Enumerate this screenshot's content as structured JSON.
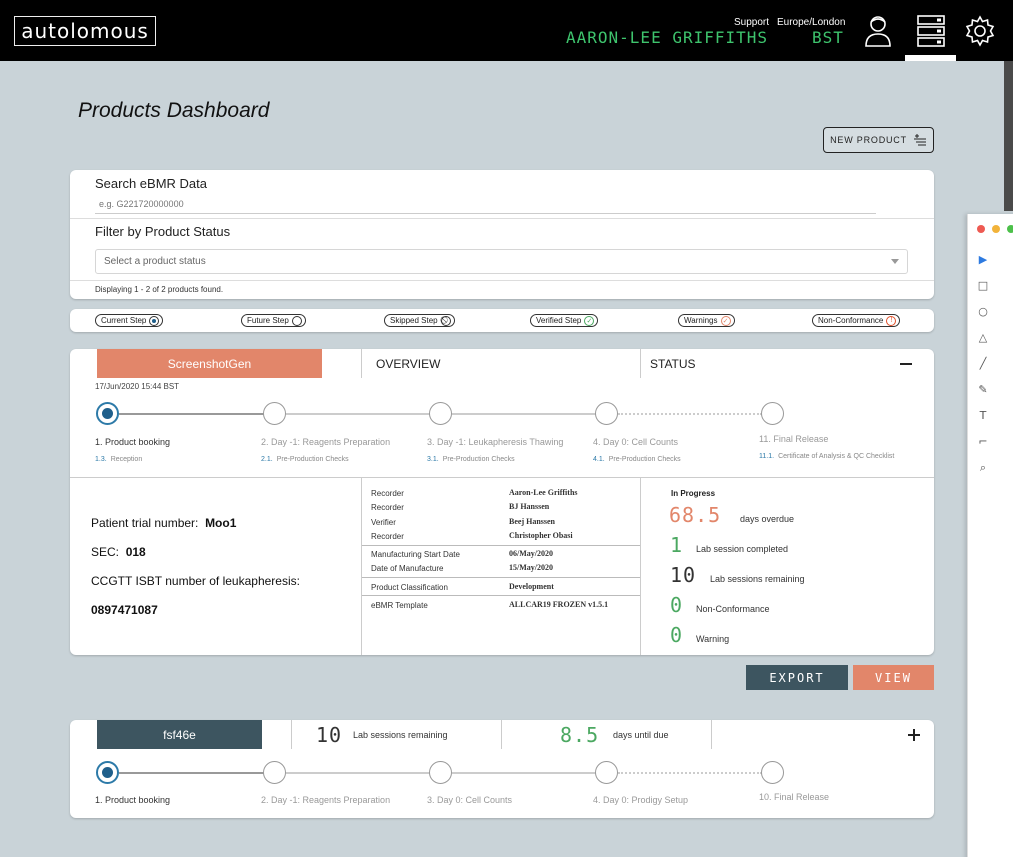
{
  "header": {
    "logo": "autolomous",
    "user_name": "AARON-LEE GRIFFITHS",
    "support": "Support",
    "region": "Europe/London",
    "timezone": "BST",
    "icons": [
      "user-icon",
      "server-icon",
      "gear-icon"
    ]
  },
  "page": {
    "title": "Products Dashboard",
    "new_product": "NEW PRODUCT"
  },
  "search": {
    "label": "Search eBMR Data",
    "placeholder": "e.g. G221720000000",
    "filter_label": "Filter by Product Status",
    "filter_placeholder": "Select a product status",
    "found": "Displaying 1 - 2 of 2 products found."
  },
  "legend": [
    {
      "label": "Current Step",
      "icon": "current-dot-icon"
    },
    {
      "label": "Future Step",
      "icon": "circle-icon"
    },
    {
      "label": "Skipped Step",
      "icon": "skip-icon"
    },
    {
      "label": "Verified Step",
      "icon": "check-icon"
    },
    {
      "label": "Warnings",
      "icon": "warning-icon"
    },
    {
      "label": "Non-Conformance",
      "icon": "alert-icon"
    }
  ],
  "product1": {
    "name": "ScreenshotGen",
    "overview_label": "OVERVIEW",
    "status_label": "STATUS",
    "date": "17/Jun/2020 15:44 BST",
    "steps": [
      {
        "label": "1. Product booking",
        "sub_num": "1.3.",
        "sub": "Reception"
      },
      {
        "label": "2. Day -1: Reagents Preparation",
        "sub_num": "2.1.",
        "sub": "Pre-Production Checks"
      },
      {
        "label": "3. Day -1: Leukapheresis Thawing",
        "sub_num": "3.1.",
        "sub": "Pre-Production Checks"
      },
      {
        "label": "4. Day 0: Cell Counts",
        "sub_num": "4.1.",
        "sub": "Pre-Production Checks"
      },
      {
        "label": "11. Final Release",
        "sub_num": "11.1.",
        "sub": "Certificate of Analysis & QC Checklist"
      }
    ],
    "patient_trial_label": "Patient trial number:",
    "patient_trial_value": "Moo1",
    "sec_label": "SEC:",
    "sec_value": "018",
    "isbt_label": "CCGTT ISBT number of leukapheresis:",
    "isbt_value": "0897471087",
    "overview": [
      {
        "label": "Recorder",
        "value": "Aaron-Lee Griffiths"
      },
      {
        "label": "Recorder",
        "value": "BJ Hanssen"
      },
      {
        "label": "Verifier",
        "value": "Beej Hanssen"
      },
      {
        "label": "Recorder",
        "value": "Christopher Obasi"
      },
      {
        "label": "Manufacturing Start Date",
        "value": "06/May/2020"
      },
      {
        "label": "Date of Manufacture",
        "value": "15/May/2020"
      },
      {
        "label": "Product Classification",
        "value": "Development"
      },
      {
        "label": "eBMR Template",
        "value": "ALLCAR19 FROZEN v1.5.1"
      }
    ],
    "status": {
      "title": "In Progress",
      "overdue_num": "68.5",
      "overdue_txt": "days overdue",
      "completed_num": "1",
      "completed_txt": "Lab session completed",
      "remaining_num": "10",
      "remaining_txt": "Lab sessions remaining",
      "nc_num": "0",
      "nc_txt": "Non-Conformance",
      "warn_num": "0",
      "warn_txt": "Warning"
    },
    "export": "EXPORT",
    "view": "VIEW"
  },
  "product2": {
    "name": "fsf46e",
    "remaining_num": "10",
    "remaining_txt": "Lab sessions remaining",
    "due_num": "8.5",
    "due_txt": "days until due",
    "steps": [
      {
        "label": "1. Product booking"
      },
      {
        "label": "2. Day -1: Reagents Preparation"
      },
      {
        "label": "3. Day 0: Cell Counts"
      },
      {
        "label": "4. Day 0: Prodigy Setup"
      },
      {
        "label": "10. Final Release"
      }
    ]
  },
  "colors": {
    "accent_orange": "#e2866a",
    "dark_slate": "#3d5560",
    "green_mono": "#3ec46d",
    "step_blue": "#1f5f8b"
  }
}
